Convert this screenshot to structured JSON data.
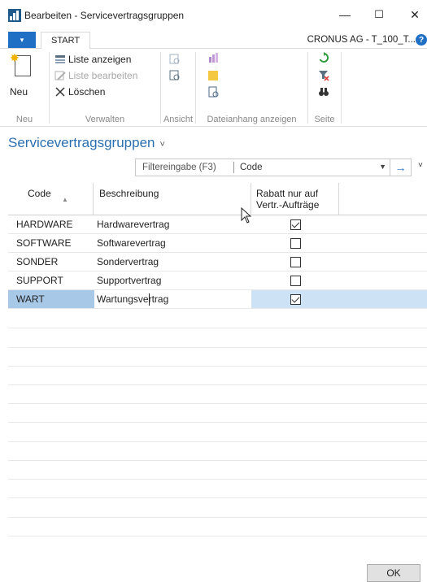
{
  "window": {
    "title": "Bearbeiten - Servicevertragsgruppen",
    "minimize": "—",
    "maximize": "☐",
    "close": "✕"
  },
  "ribbon": {
    "file_icon": "▾",
    "tab": "START",
    "company": "CRONUS AG - T_100_T...",
    "help": "?",
    "groups": {
      "neu": {
        "label": "Neu",
        "new_button": "Neu"
      },
      "verwalten": {
        "label": "Verwalten",
        "show_list": "Liste anzeigen",
        "edit_list": "Liste bearbeiten",
        "delete": "Löschen"
      },
      "ansicht": {
        "label": "Ansicht"
      },
      "anhang": {
        "label": "Dateianhang anzeigen"
      },
      "seite": {
        "label": "Seite"
      }
    }
  },
  "page": {
    "title": "Servicevertragsgruppen",
    "title_chevron": "˅"
  },
  "filter": {
    "label": "Filtereingabe (F3)",
    "field": "Code",
    "dropdown": "▼",
    "apply": "→",
    "collapse": "˅"
  },
  "grid": {
    "columns": {
      "code": "Code",
      "description": "Beschreibung",
      "discount_line1": "Rabatt nur auf",
      "discount_line2": "Vertr.-Aufträge"
    },
    "rows": [
      {
        "code": "HARDWARE",
        "description": "Hardwarevertrag",
        "discount": true
      },
      {
        "code": "SOFTWARE",
        "description": "Softwarevertrag",
        "discount": false
      },
      {
        "code": "SONDER",
        "description": "Sondervertrag",
        "discount": false
      },
      {
        "code": "SUPPORT",
        "description": "Supportvertrag",
        "discount": false
      },
      {
        "code": "WART",
        "description": "Wartungsvertrag",
        "discount": true
      }
    ]
  },
  "footer": {
    "ok": "OK"
  },
  "colors": {
    "accent": "#1f6fc5",
    "title_blue": "#2a6fb0",
    "selected_row": "#cde3f5"
  }
}
